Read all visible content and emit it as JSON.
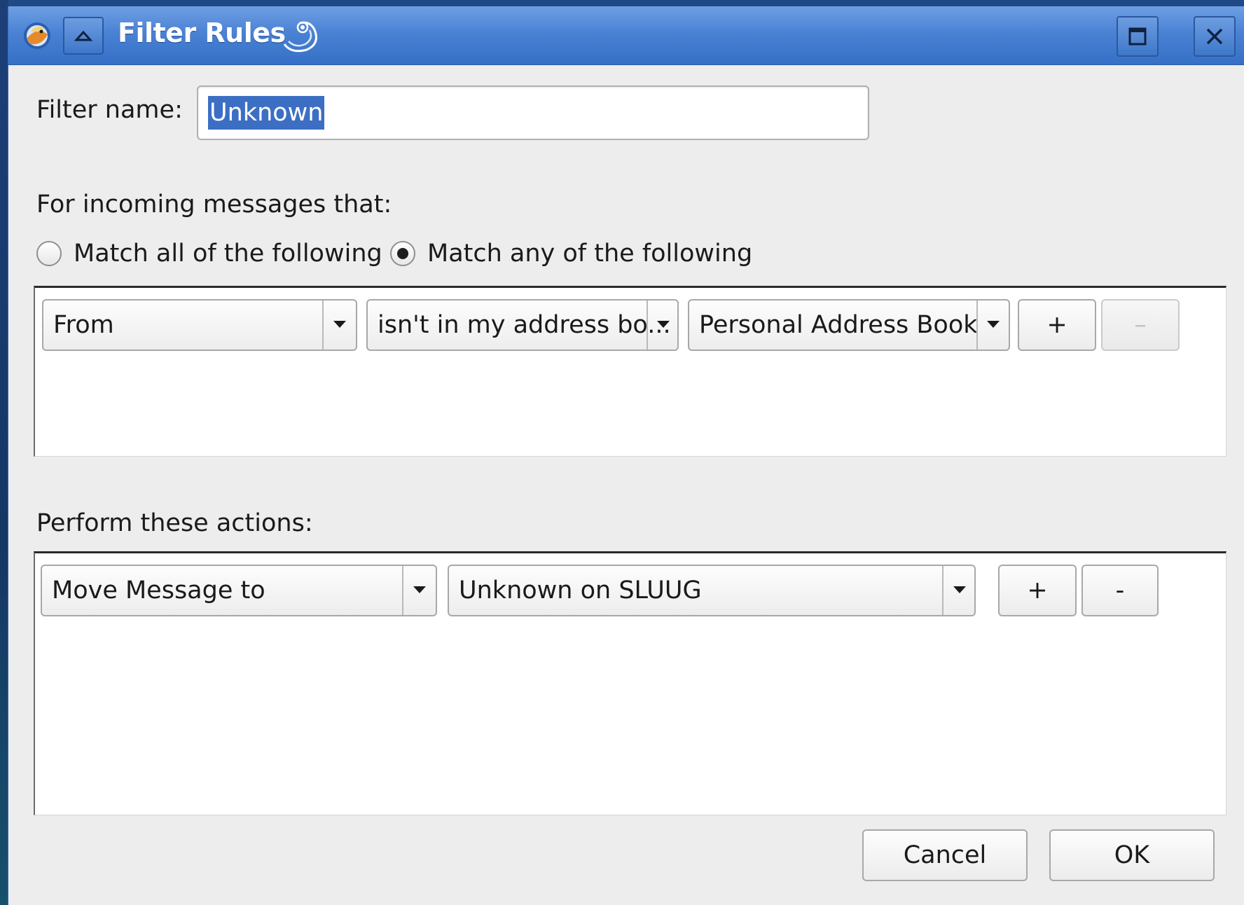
{
  "window": {
    "title": "Filter Rules"
  },
  "filter_name": {
    "label": "Filter name:",
    "value": "Unknown"
  },
  "incoming": {
    "heading": "For incoming messages that:",
    "match_all_label": "Match all of the following",
    "match_any_label": "Match any of the following",
    "selected": "any"
  },
  "rule": {
    "field": "From",
    "condition": "isn't in my address bo...",
    "book": "Personal Address Book",
    "add_label": "+",
    "remove_label": "–"
  },
  "actions": {
    "heading": "Perform these actions:",
    "action": "Move Message to",
    "target": "Unknown on SLUUG",
    "add_label": "+",
    "remove_label": "-"
  },
  "buttons": {
    "cancel": "Cancel",
    "ok": "OK"
  },
  "icons": {
    "app": "thunderbird-app-icon",
    "shade": "shade-up-icon",
    "title_decoration": "swirl-icon",
    "maximize": "maximize-icon",
    "close": "close-icon"
  },
  "colors": {
    "titlebar": "#4a82d4",
    "selection": "#3c6fc4",
    "dialog_bg": "#ededed"
  }
}
